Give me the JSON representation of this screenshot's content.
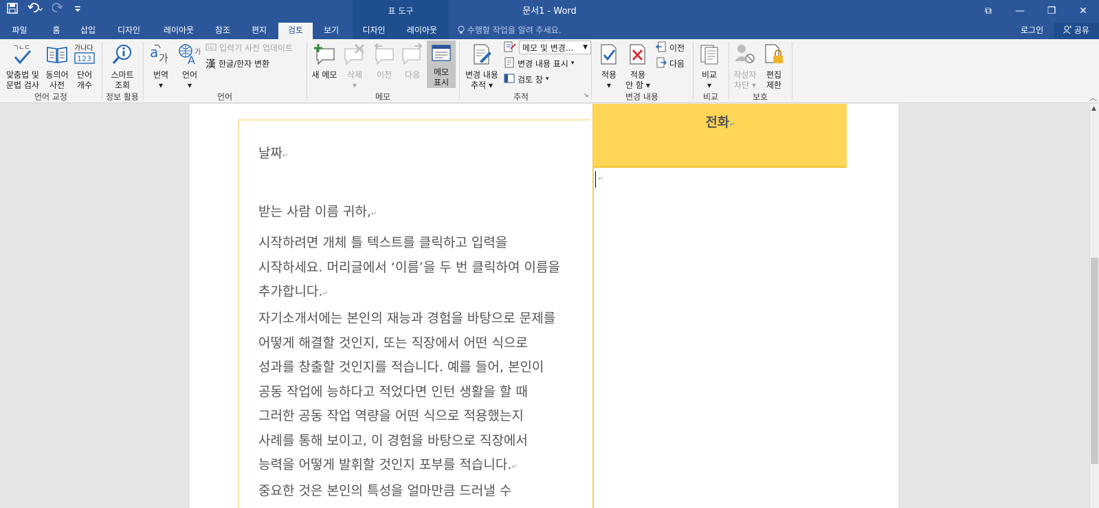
{
  "window": {
    "title": "문서1 - Word",
    "tool_context": "표 도구",
    "qat": {
      "save_icon": "save-icon",
      "undo_icon": "undo-icon",
      "redo_icon": "redo-icon",
      "customize_icon": "customize-icon"
    },
    "controls": {
      "ribbon_display": "⧉",
      "minimize": "—",
      "restore": "❐",
      "close": "✕"
    }
  },
  "tabs": [
    {
      "label": "파일"
    },
    {
      "label": "홈"
    },
    {
      "label": "삽입"
    },
    {
      "label": "디자인"
    },
    {
      "label": "레이아웃"
    },
    {
      "label": "참조"
    },
    {
      "label": "편지"
    },
    {
      "label": "검토"
    },
    {
      "label": "보기"
    },
    {
      "label": "디자인"
    },
    {
      "label": "레이아웃"
    }
  ],
  "tell_me": "수행할 작업을 알려 주세요.",
  "sign_in": "로그인",
  "share": "공유",
  "ribbon": {
    "groups": {
      "proofing": "언어 교정",
      "insights": "정보 활용",
      "language": "언어",
      "comments": "메모",
      "tracking": "추적",
      "changes": "변경 내용",
      "compare": "비교",
      "protect": "보호"
    },
    "buttons": {
      "spelling_1": "맞춤법 및",
      "spelling_2": "문법 검사",
      "thesaurus_1": "동의어",
      "thesaurus_2": "사전",
      "wordcount_1": "단어",
      "wordcount_2": "개수",
      "smart_1": "스마트",
      "smart_2": "조회",
      "translate": "번역",
      "language": "언어",
      "ime_update": "입력기 사전 업데이트",
      "hanja": "한글/한자 변환",
      "new_comment": "새 메모",
      "delete": "삭제",
      "previous": "이전",
      "next": "다음",
      "show_comments_1": "메모",
      "show_comments_2": "표시",
      "track_1": "변경 내용",
      "track_2": "추적",
      "markup_dropdown": "메모 및 변경...",
      "show_markup": "변경 내용 표시",
      "review_pane": "검토 창",
      "accept": "적용",
      "reject_1": "적용",
      "reject_2": "안 함",
      "change_prev": "이전",
      "change_next": "다음",
      "compare": "비교",
      "block_1": "작성자",
      "block_2": "차단",
      "restrict_1": "편집",
      "restrict_2": "제한"
    }
  },
  "document": {
    "phone_label": "전화",
    "date": "날짜",
    "salutation": "받는 사람 이름 귀하,",
    "para1": [
      "시작하려면 개체 틀 텍스트를 클릭하고 입력을",
      "시작하세요. 머리글에서 ‘이름’을 두 번 클릭하여 이름을",
      "추가합니다."
    ],
    "para2": [
      "자기소개서에는 본인의 재능과 경험을 바탕으로 문제를",
      "어떻게 해결할 것인지, 또는 직장에서 어떤 식으로",
      "성과를 창출할 것인지를 적습니다. 예를 들어, 본인이",
      "공동 작업에 능하다고 적었다면 인턴 생활을 할 때",
      "그러한 공동 작업 역량을 어떤 식으로 적용했는지",
      "사례를 통해 보이고, 이 경험을 바탕으로 직장에서",
      "능력을 어떻게 발휘할 것인지 포부를 적습니다."
    ],
    "para3": [
      "중요한 것은 본인의 특성을 얼마만큼 드러낼 수"
    ],
    "pilcrow": "↵"
  }
}
